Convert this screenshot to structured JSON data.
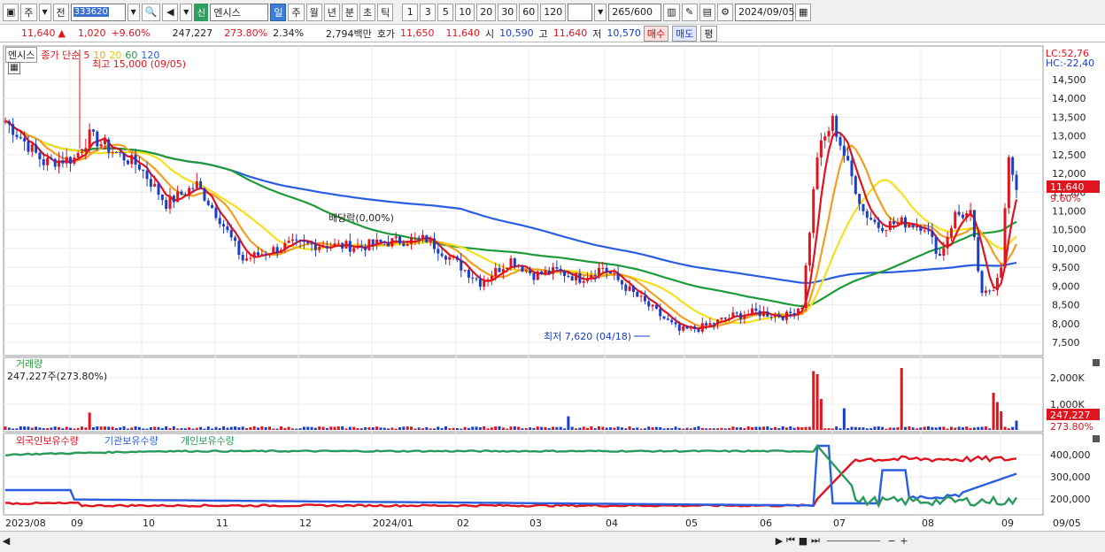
{
  "toolbar": {
    "period_buttons": [
      "주",
      "전"
    ],
    "code": "333620",
    "market_tag": "신",
    "stock_name": "엔시스",
    "interval_buttons": [
      "일",
      "주",
      "월",
      "년",
      "분",
      "초",
      "틱"
    ],
    "active_interval": "일",
    "minute_buttons": [
      "1",
      "3",
      "5",
      "10",
      "20",
      "30",
      "60",
      "120"
    ],
    "count": "265",
    "count_total": "/600",
    "date": "2024/09/05"
  },
  "quote": {
    "price": "11,640",
    "change_arrow": "▲",
    "change": "1,020",
    "change_pct": "+9.60%",
    "volume": "247,227",
    "volume_ratio": "273.80%",
    "turnover_pct": "2.34%",
    "amount": "2,794백만",
    "ask_label": "호가",
    "ask": "11,650",
    "bid": "11,640",
    "open_label": "시",
    "open": "10,590",
    "high_label": "고",
    "high": "11,640",
    "low_label": "저",
    "low": "10,570",
    "buy_label": "매수",
    "sell_label": "매도",
    "eval_label": "평"
  },
  "price_panel": {
    "name_tag": "엔시스",
    "legend_title": "종가 단순",
    "ma_labels": [
      "5",
      "10",
      "20",
      "60",
      "120"
    ],
    "high_annotation": "최고 15,000 (09/05)",
    "low_annotation": "최저 7,620 (04/18)",
    "dividend_annotation": "배당락(0,00%)",
    "lc_label": "LC:52,76",
    "hc_label": "HC:-22,40",
    "y_ticks": [
      "14,500",
      "14,000",
      "13,500",
      "13,000",
      "12,500",
      "12,000",
      "11,500",
      "11,000",
      "10,500",
      "10,000",
      "9,500",
      "9,000",
      "8,500",
      "8,000",
      "7,500"
    ],
    "price_tag": "11,640",
    "pct_tag": "9.60%"
  },
  "volume_panel": {
    "title": "거래량",
    "value": "247,227주(273.80%)",
    "y_ticks": [
      "2,000K",
      "1,000K"
    ],
    "vol_tag": "247,227",
    "pct_tag": "273.80%"
  },
  "holding_panel": {
    "legend": [
      "외국인보유수량",
      "기관보유수량",
      "개인보유수량"
    ],
    "y_ticks": [
      "400,000",
      "300,000",
      "200,000"
    ]
  },
  "x_axis": {
    "labels": [
      "2023/08",
      "09",
      "10",
      "11",
      "12",
      "2024/01",
      "02",
      "03",
      "04",
      "05",
      "06",
      "07",
      "08",
      "09",
      "09/05"
    ]
  },
  "colors": {
    "up": "#e0141e",
    "down": "#1a3ec8",
    "ma5": "#e0141e",
    "ma10": "#f0a020",
    "ma20": "#f5e020",
    "ma60": "#1f9a3a",
    "ma120": "#2a5ee0",
    "foreign": "#e0141e",
    "institution": "#2a5ee0",
    "individual": "#2a9a5a"
  }
}
